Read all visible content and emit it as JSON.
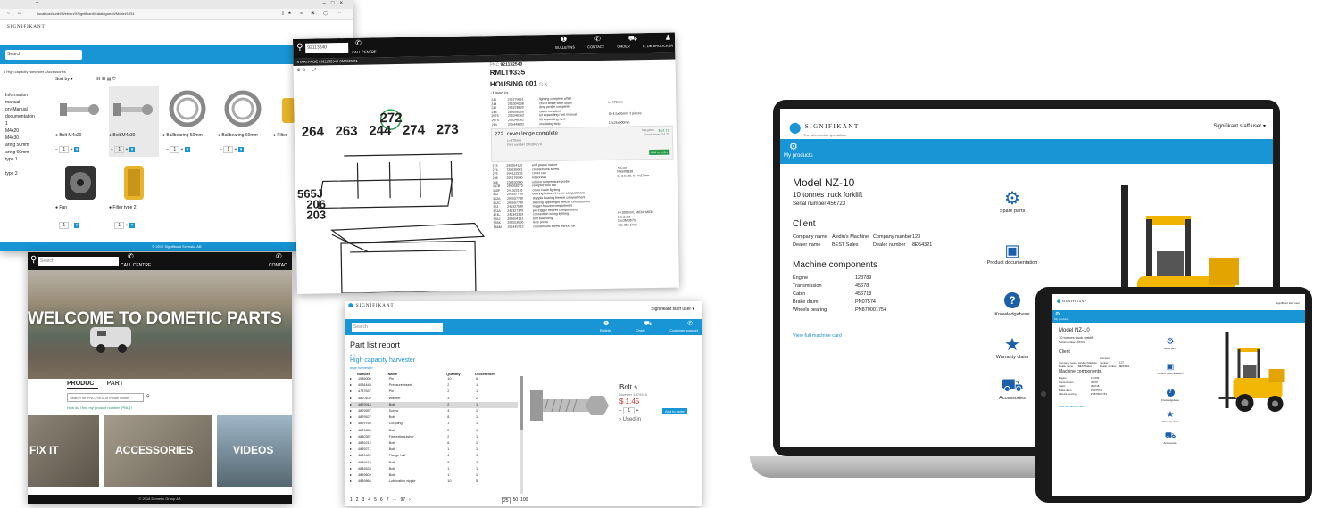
{
  "s1": {
    "tab_plus": "+",
    "url": "localhost/Actel/Web/en/XSignifikant/Catalogue/M/Model/1051",
    "win_controls": [
      "–",
      "□",
      "×"
    ],
    "brand": "SIGNIFIKANT",
    "search_placeholder": "Search",
    "breadcrumb": "1 High capacity harvester  /  Accessories",
    "sort_label": "Sort by",
    "sidebar": [
      "Information",
      "manual",
      "ory Manual",
      "documentation",
      "1",
      "M4x20",
      "M4x30",
      "aring 50mm",
      "aring 60mm",
      "type 1",
      "",
      "type 2"
    ],
    "products": [
      {
        "name": "Bolt M4x20"
      },
      {
        "name": "Bolt M4x30"
      },
      {
        "name": "Ballbearing 50mm"
      },
      {
        "name": "Ballbearing 60mm"
      },
      {
        "name": "Filter"
      },
      {
        "name": "Fan"
      },
      {
        "name": "Filter type 2"
      }
    ],
    "qty": "1",
    "footer": "© 2017 Signifikant Svenska AB"
  },
  "s2": {
    "search": "92113240",
    "call_centre": "CALL CENTRE",
    "nav": [
      "BULLETINS",
      "CONTACT",
      "ORDER",
      "K. DE BRUIJCKER"
    ],
    "crumbs": "STARTPAGE  /  921132540 SM0325/01",
    "pnc_label": "PNC",
    "pnc": "921132540",
    "model": "RMLT9335",
    "housing": "HOUSING 001",
    "used_in": "› Used in",
    "labels_top": [
      "272"
    ],
    "labels_row": [
      "264",
      "263",
      "244",
      "274",
      "273"
    ],
    "labels_side": [
      "565J",
      "206",
      "203"
    ],
    "label_mid": "???",
    "parts_top": [
      [
        "240",
        "295779651",
        "lighting complete white",
        ""
      ],
      [
        "244",
        "295304238",
        "cover ledge back upper",
        "L=470mm"
      ],
      [
        "247",
        "295228620",
        "drop profile complete",
        ""
      ],
      [
        "248",
        "289058200",
        "catch complete",
        ""
      ],
      [
        "257S",
        "295246162",
        "kit expanding rivet manual",
        "D=4.5x10mm, 3 pieces"
      ],
      [
        "257S",
        "295246162",
        "kit expanding rivet",
        ""
      ],
      [
        "264",
        "295449802",
        "insulating strip",
        "12x26x500mm"
      ]
    ],
    "selected": {
      "pos": "272",
      "title": "cover ledge complete",
      "sub": "L=470mm",
      "pn": "Part number 295304270",
      "price_label": "Net price",
      "price": "$14.72",
      "list": "Gross price $14.72",
      "btn": "Add to order"
    },
    "parts_bottom": [
      [
        "273",
        "295054120",
        "end plastic nature",
        ""
      ],
      [
        "274",
        "728635001",
        "countersunk screw",
        "4.2x32"
      ],
      [
        "275",
        "299122235",
        "cover cap",
        "NS5/08838"
      ],
      [
        "286",
        "295176590",
        "kit screws",
        "6x 3.5x30, 6x 4x17mm"
      ],
      [
        "306",
        "238630300",
        "interior temperature probe",
        ""
      ],
      [
        "347B",
        "289058270",
        "receptor lock tab",
        ""
      ],
      [
        "350F",
        "241322131",
        "cover cable lighting",
        ""
      ],
      [
        "352",
        "292557739",
        "bearing bottom freezer compartment",
        ""
      ],
      [
        "352A",
        "292557730",
        "stopple bearing freezer compartment",
        ""
      ],
      [
        "352C",
        "292557740",
        "bearing upper right freezer compartment",
        ""
      ],
      [
        "353",
        "241327540",
        "trigger freezer compartment",
        ""
      ],
      [
        "353A",
        "241327370",
        "pin trigger freezer compartment",
        ""
      ],
      [
        "474L",
        "241343319",
        "connection wiring lighting",
        "L=1000mm, M034/ M034"
      ],
      [
        "565J",
        "292654181",
        "bolt balancing",
        "8.5.3x13"
      ],
      [
        "565K",
        "292553600",
        "lens screw",
        "5xx3M:3b79"
      ],
      [
        "566M",
        "292445713",
        "countersunk screw without bit",
        "C3, 3b5.5mm"
      ]
    ]
  },
  "s3": {
    "search_placeholder": "Search",
    "call_centre": "CALL CENTRE",
    "contact": "CONTAC",
    "hero": "WELCOME TO DOMETIC PARTS",
    "tab_product": "PRODUCT",
    "tab_part": "PART",
    "search2": "Search for PNC, SKU or model name",
    "help": "How do I find my product number (PNC)?",
    "tiles": [
      "FIX IT",
      "ACCESSORIES",
      "VIDEOS"
    ],
    "footer": "© 2018 Dometic Group AB"
  },
  "s4": {
    "brand": "SIGNIFIKANT",
    "user": "Signifikant staff user",
    "search_placeholder": "Search",
    "nav": [
      "Bulletin",
      "Order",
      "Customer support"
    ],
    "title": "Part list report",
    "crumb": "911",
    "subtitle": "High capacity harvester",
    "crumb2": "arge harvester",
    "headers": [
      "Number",
      "Name",
      "Quantity",
      "Occurrences"
    ],
    "rows": [
      [
        "1585000",
        "Pin",
        "10",
        "6"
      ],
      [
        "4034448",
        "Pressure insert",
        "2",
        "1"
      ],
      [
        "4787637",
        "Pin",
        "2",
        "1"
      ],
      [
        "4870102",
        "Washer",
        "3",
        "2"
      ],
      [
        "4879916",
        "Bolt",
        "2",
        "1"
      ],
      [
        "4879557",
        "Screw",
        "4",
        "1"
      ],
      [
        "4879527",
        "Bolt",
        "8",
        "1"
      ],
      [
        "4879766",
        "Coupling",
        "1",
        "1"
      ],
      [
        "4879836",
        "Bolt",
        "2",
        "1"
      ],
      [
        "4880357",
        "Fire extinguisher",
        "2",
        "1"
      ],
      [
        "4889212",
        "Bolt",
        "6",
        "1"
      ],
      [
        "4889271",
        "Bolt",
        "1",
        "1"
      ],
      [
        "4889402",
        "Flange half",
        "4",
        "1"
      ],
      [
        "4889415",
        "Bolt",
        "8",
        "2"
      ],
      [
        "4889524",
        "Bolt",
        "1",
        "1"
      ],
      [
        "4889609",
        "Bolt",
        "1",
        "1"
      ],
      [
        "4889866",
        "Lubrication nipple",
        "10",
        "5"
      ]
    ],
    "detail_title": "Bolt",
    "detail_number": "Number 4879916",
    "detail_price": "$ 1.45",
    "detail_qty": "1",
    "detail_btn": "Add to order",
    "detail_used": "› Used in",
    "pages": [
      "1",
      "2",
      "3",
      "4",
      "5",
      "6",
      "7",
      "97"
    ],
    "per_page": [
      "25",
      "50",
      "100"
    ]
  },
  "s5": {
    "brand": "SIGNIFIKANT",
    "brand_sub": "The aftermarket specialists",
    "user": "Signifikant staff user",
    "nav": "My products",
    "model": "Model NZ-10",
    "subtitle": "10 tonnes truck forklift",
    "serial": "Serial number   456723",
    "client_title": "Client",
    "client": [
      [
        "Company name",
        "Avidin's Machine"
      ],
      [
        "Dealer name",
        "BEST Sales"
      ]
    ],
    "client2": [
      [
        "Company number",
        "123"
      ],
      [
        "Dealer number",
        "8Ð54321"
      ]
    ],
    "mc_title": "Machine components",
    "components": [
      [
        "Engine",
        "123789"
      ],
      [
        "Transmission",
        "45678"
      ],
      [
        "Cabin",
        "456718"
      ],
      [
        "Brake drum",
        "PN07574"
      ],
      [
        "Wheels bearing",
        "PN870001754"
      ]
    ],
    "link": "View full machine card",
    "actions": [
      "Spare parts",
      "Product documentation",
      "Knowledgebase",
      "Warranty claim",
      "Accessories"
    ]
  },
  "colors": {
    "blue": "#1795d4",
    "dark": "#1c1c1c",
    "price": "#d32f2f"
  }
}
